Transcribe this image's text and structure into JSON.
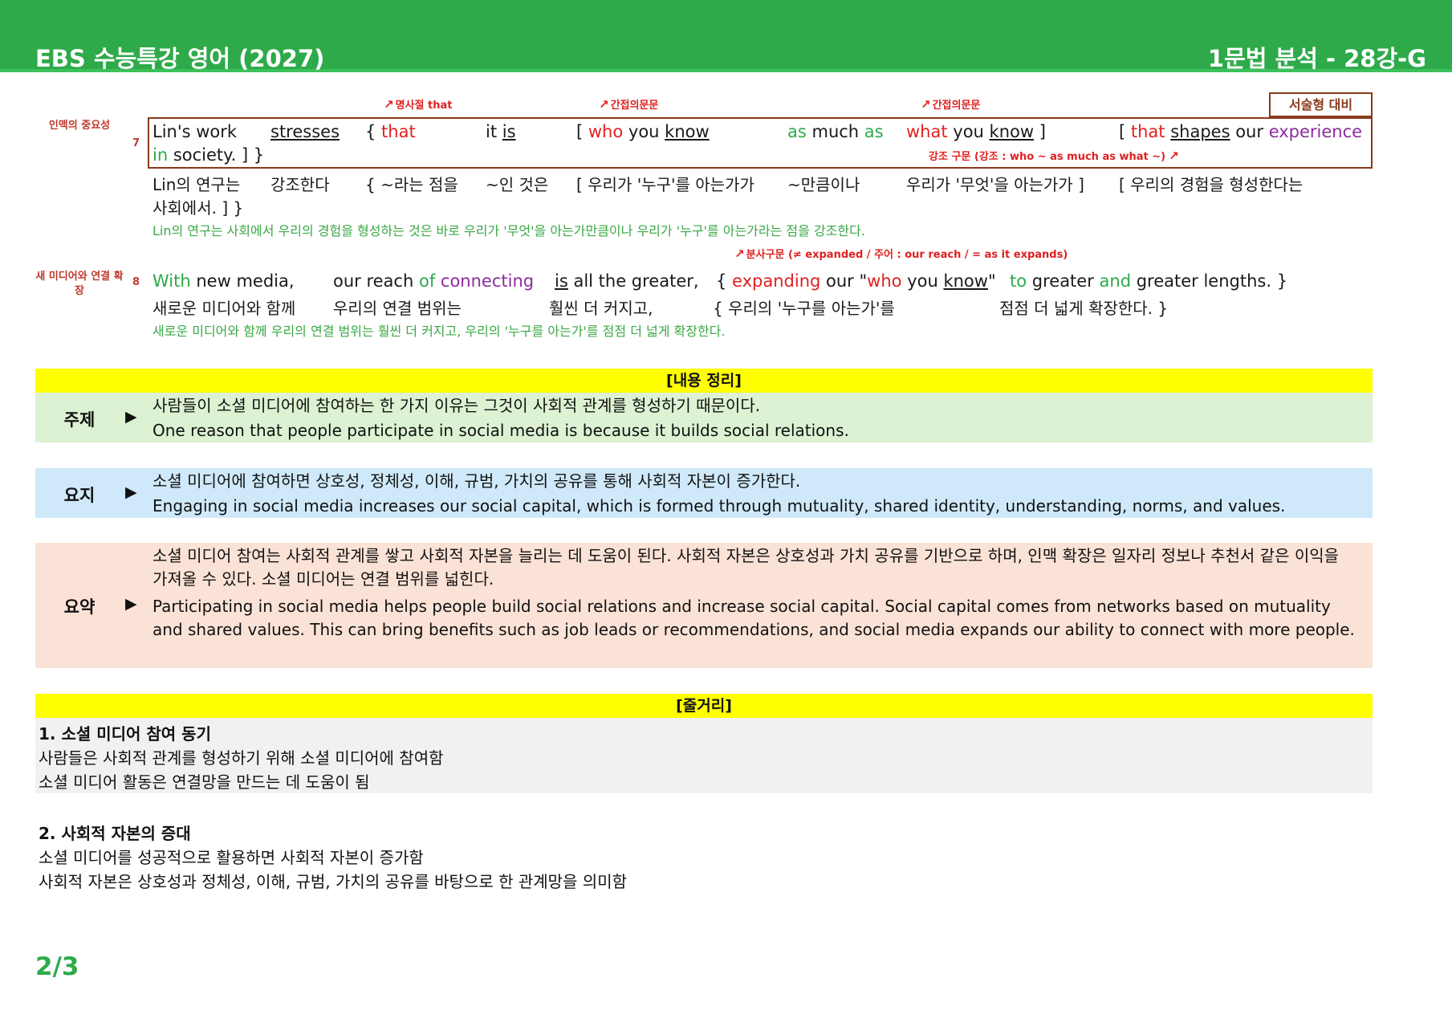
{
  "header": {
    "title": "EBS 수능특강 영어 (2027)",
    "section": "1문법 분석 - 28강-G"
  },
  "badge": "서술형 대비",
  "s7": {
    "topic": "인맥의 중요성",
    "num": "7",
    "notes": {
      "n1": "명사절 that",
      "n2": "간접의문문",
      "n3": "간접의문문",
      "n4": "강조 구문 (강조 : who ~ as much as what ~)"
    },
    "en": {
      "a": "Lin's work",
      "b": "stresses",
      "c1": "{ ",
      "c2": "that",
      "d1": "it ",
      "d2": "is",
      "e1": "[ ",
      "e2": "who",
      "e3": " you ",
      "e4": "know",
      "f1": "as",
      "f2": " much ",
      "f3": "as",
      "g1": "what",
      "g2": " you ",
      "g3": "know",
      "g4": " ]",
      "h1": "[ ",
      "h2": "that",
      "h3": " ",
      "h4": "shapes",
      "h5": " our ",
      "h6": "experience",
      "i1": "in",
      "i2": " society. ] }"
    },
    "ko": {
      "a": "Lin의 연구는",
      "b": "강조한다",
      "c": "{ ~라는 점을",
      "d": "~인 것은",
      "e": "[ 우리가 '누구'를 아는가가",
      "f": "~만큼이나",
      "g": "우리가 '무엇'을 아는가가 ]",
      "h": "[ 우리의 경험을 형성한다는",
      "i": "사회에서. ] }"
    },
    "trans": "Lin의 연구는 사회에서 우리의 경험을 형성하는 것은 바로 우리가 '무엇'을 아는가만큼이나 우리가 '누구'를 아는가라는 점을 강조한다."
  },
  "s8": {
    "topic": "새 미디어와 연결 확장",
    "num": "8",
    "note": "분사구문 (≠ expanded / 주어 : our reach / = as it expands)",
    "en": {
      "a1": "With",
      "a2": " new media,",
      "b1": "our reach ",
      "b2": "of",
      "b3": " ",
      "b4": "connecting",
      "c1": "is",
      "c2": " all the greater,",
      "d1": "{ ",
      "d2": "expanding",
      "d3": " our \"",
      "d4": "who",
      "d5": " you ",
      "d6": "know",
      "d7": "\"",
      "e1": "to",
      "e2": " greater ",
      "e3": "and",
      "e4": " greater lengths. }"
    },
    "ko": {
      "a": "새로운 미디어와 함께",
      "b": "우리의 연결 범위는",
      "c": "훨씬 더 커지고,",
      "d": "{ 우리의 '누구를 아는가'를",
      "e": "점점 더 넓게 확장한다. }"
    },
    "trans": "새로운 미디어와 함께 우리의 연결 범위는 훨씬 더 커지고, 우리의 '누구를 아는가'를 점점 더 넓게 확장한다."
  },
  "summary": {
    "header": "[내용 정리]",
    "marker": "▶",
    "topic": {
      "label": "주제",
      "ko": "사람들이 소셜 미디어에 참여하는 한 가지 이유는 그것이 사회적 관계를 형성하기 때문이다.",
      "en": "One reason that people participate in social media is because it builds social relations."
    },
    "gist": {
      "label": "요지",
      "ko": "소셜 미디어에 참여하면 상호성, 정체성, 이해, 규범, 가치의 공유를 통해 사회적 자본이 증가한다.",
      "en": "Engaging in social media increases our social capital, which is formed through mutuality, shared identity, understanding, norms, and values."
    },
    "abstract": {
      "label": "요약",
      "ko": "소셜 미디어 참여는 사회적 관계를 쌓고 사회적 자본을 늘리는 데 도움이 된다. 사회적 자본은 상호성과 가치 공유를 기반으로 하며, 인맥 확장은 일자리 정보나 추천서 같은 이익을 가져올 수 있다. 소셜 미디어는 연결 범위를 넓힌다.",
      "en": "Participating in social media helps people build social relations and increase social capital. Social capital comes from networks based on mutuality and shared values. This can bring benefits such as job leads or recommendations, and social media expands our ability to connect with more people."
    }
  },
  "outline": {
    "header": "[줄거리]",
    "p1": {
      "title": "1. 소셜 미디어 참여 동기",
      "l1": "사람들은 사회적 관계를 형성하기 위해 소셜 미디어에 참여함",
      "l2": "소셜 미디어 활동은 연결망을 만드는 데 도움이 됨"
    },
    "p2": {
      "title": "2. 사회적 자본의 증대",
      "l1": "소셜 미디어를 성공적으로 활용하면 사회적 자본이 증가함",
      "l2": "사회적 자본은 상호성과 정체성, 이해, 규범, 가치의 공유를 바탕으로 한 관계망을 의미함"
    }
  },
  "page": "2/3"
}
